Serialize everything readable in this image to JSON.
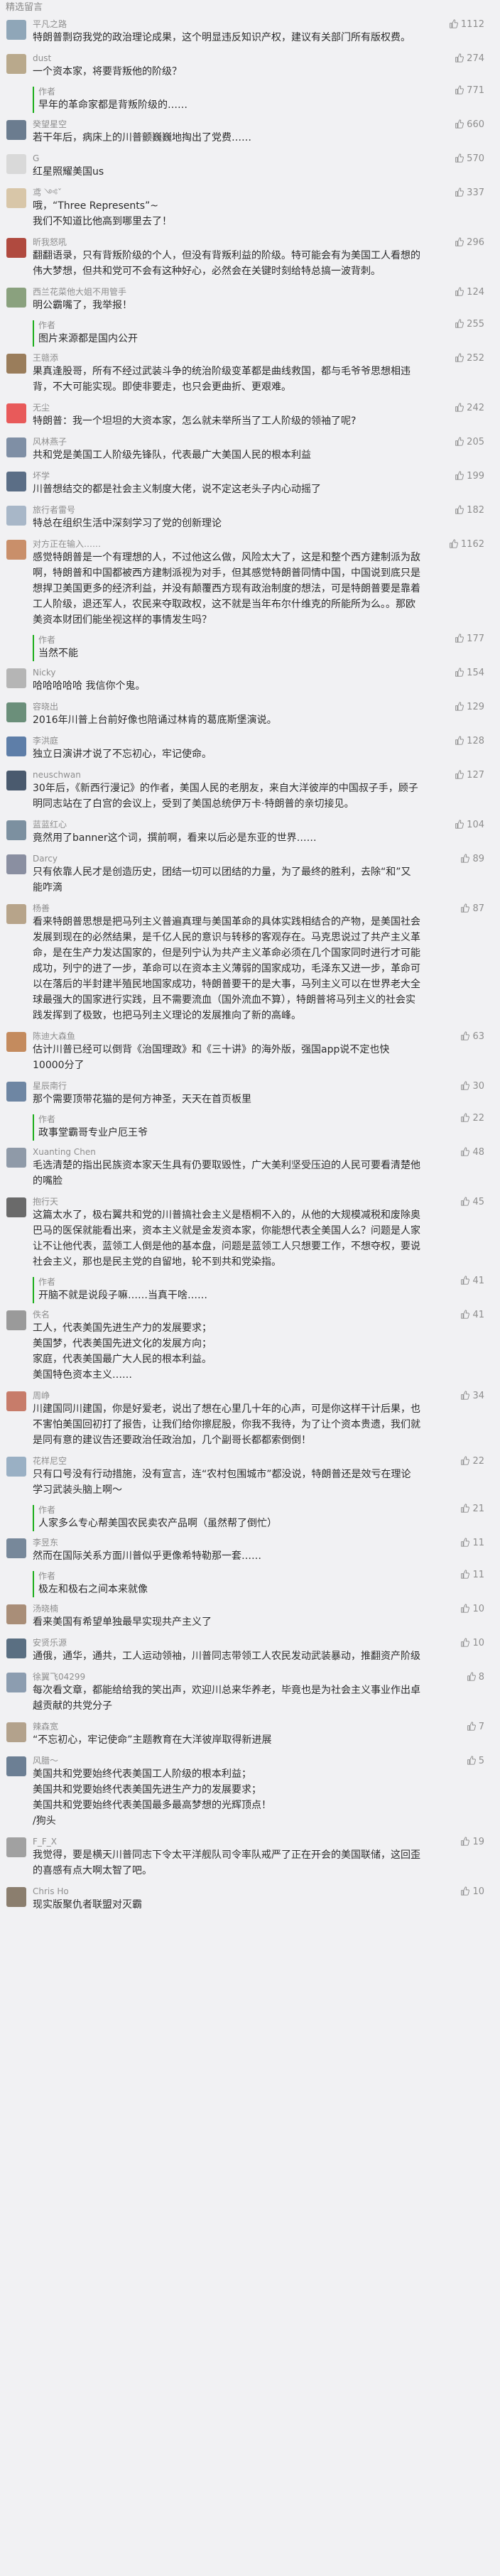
{
  "section_title": "精选留言",
  "colors": {
    "accent_green": "#1aad19",
    "text_gray": "#8e8e8e",
    "background": "#f1f1f3"
  },
  "icons": {
    "like": "thumbs-up-icon",
    "avatar": "user-avatar"
  },
  "comments": [
    {
      "name": "平凡之路",
      "likes": "1112",
      "text": "特朗普剽窃我党的政治理论成果，这个明显违反知识产权，建议有关部门所有版权费。",
      "avatar_color": "#8fa6b8"
    },
    {
      "name": "dust",
      "likes": "274",
      "text": "一个资本家，将要背叛他的阶级？",
      "avatar_color": "#b9a98c",
      "reply": {
        "author": "作者",
        "likes": "771",
        "text": "早年的革命家都是背叛阶级的……"
      }
    },
    {
      "name": "癸望星空",
      "likes": "660",
      "text": "若干年后，病床上的川普颤巍巍地掏出了党费……",
      "avatar_color": "#6b7c8f"
    },
    {
      "name": "G",
      "likes": "570",
      "text": "红星照耀美国us",
      "avatar_color": "#d9d9d9"
    },
    {
      "name": "鸢 ༺ˇ",
      "likes": "337",
      "text": "哦，“Three Represents”~\n我们不知道比他高到哪里去了！",
      "avatar_color": "#d8c6a8"
    },
    {
      "name": "昕我怒吼",
      "likes": "296",
      "text": "翻翻语录，只有背叛阶级的个人，但没有背叛利益的阶级。特可能会有为美国工人看想的伟大梦想，但共和党可不会有这种好心，必然会在关键时刻给特总搞一波背刺。",
      "avatar_color": "#b04a3f"
    },
    {
      "name": "西兰花菜他大姐不用管手",
      "likes": "124",
      "text": "明公霸嘴了，我举报！",
      "avatar_color": "#8aa17e",
      "reply": {
        "author": "作者",
        "likes": "255",
        "text": "图片来源都是国内公开"
      }
    },
    {
      "name": "王赣添",
      "likes": "252",
      "text": "果真逢股哥，所有不经过武装斗争的统治阶级变革都是曲线救国，都与毛爷爷思想相违背，不大可能实现。即使非要走，也只会更曲折、更艰难。",
      "avatar_color": "#9a7d5b"
    },
    {
      "name": "无尘",
      "likes": "242",
      "text": "特朗普：我一个坦坦的大资本家，怎么就未举所当了工人阶级的领袖了呢?",
      "avatar_color": "#e85a5a"
    },
    {
      "name": "风林燕子",
      "likes": "205",
      "text": "共和党是美国工人阶级先锋队，代表最广大美国人民的根本利益",
      "avatar_color": "#7f8fa5"
    },
    {
      "name": "坏学",
      "likes": "199",
      "text": "川普想结交的都是社会主义制度大佬，说不定这老头子内心动摇了",
      "avatar_color": "#5b6e86"
    },
    {
      "name": "旅行者雷号",
      "likes": "182",
      "text": "特总在组织生活中深刻学习了党的创新理论",
      "avatar_color": "#a8b7c8"
    },
    {
      "name": "对方正在输入……",
      "likes": "1162",
      "text": "感觉特朗普是一个有理想的人，不过他这么做，风险太大了，这是和整个西方建制派为敌啊，特朗普和中国都被西方建制派视为对手，但其感觉特朗普同情中国，中国说到底只是想捍卫美国更多的经济利益，并没有颠覆西方现有政治制度的想法，可是特朗普要是靠着工人阶级，退还军人，农民来夺取政权，这不就是当年布尔什维克的所能所为么。。那欧美资本财团们能坐视这样的事情发生吗？",
      "avatar_color": "#c98f6a",
      "reply": {
        "author": "作者",
        "likes": "177",
        "text": "当然不能"
      }
    },
    {
      "name": "Nicky",
      "likes": "154",
      "text": "哈哈哈哈哈 我信你个鬼。",
      "avatar_color": "#b5b5b5"
    },
    {
      "name": "容晓出",
      "likes": "129",
      "text": "2016年川普上台前好像也陪诵过林肯的葛底斯堡演说。",
      "avatar_color": "#6b8f7a"
    },
    {
      "name": "李洪庭",
      "likes": "128",
      "text": "独立日演讲才说了不忘初心，牢记使命。",
      "avatar_color": "#5e7ea8"
    },
    {
      "name": "neuschwan",
      "likes": "127",
      "text": "30年后，《新西行漫记》的作者，美国人民的老朋友，来自大洋彼岸的中国叔子手，顾子明同志站在了白宫的会议上，受到了美国总统伊万卡·特朗普的亲切接见。",
      "avatar_color": "#4a5a6e"
    },
    {
      "name": "蓝蓝红心",
      "likes": "104",
      "text": "竟然用了banner这个词，撰前啊，看来以后必是东亚的世界……",
      "avatar_color": "#7c90a0"
    },
    {
      "name": "Darcy",
      "likes": "89",
      "text": "只有依靠人民才是创造历史，团结一切可以团结的力量，为了最终的胜利，去除“和”又能咋滴",
      "avatar_color": "#8a8fa1"
    },
    {
      "name": "杨善",
      "likes": "87",
      "text": "看来特朗普思想是把马列主义普遍真理与美国革命的具体实践相结合的产物，是美国社会发展到现在的必然结果，是千亿人民的意识与转移的客观存在。马克思说过了共产主义革命，是在生产力发达国家的，但是列宁认为共产主义革命必须在几个国家同时进行才可能成功，列宁的进了一步，革命可以在资本主义薄弱的国家成功，毛泽东又进一步，革命可以在落后的半封建半殖民地国家成功，特朗普要干的是大事，马列主义可以在世界老大全球最强大的国家进行实践，且不需要流血（国外流血不算），特朗普将马列主义的社会实践发挥到了极致，也把马列主义理论的发展推向了新的高峰。",
      "avatar_color": "#b7a48a"
    },
    {
      "name": "陈迪大森鱼",
      "likes": "63",
      "text": "估计川普已经可以倒背《治国理政》和《三十讲》的海外版，强国app说不定也快10000分了",
      "avatar_color": "#c48b5e"
    },
    {
      "name": "星辰南行",
      "likes": "30",
      "text": "那个需要顶带花猫的是何方神圣，天天在首页板里",
      "avatar_color": "#6e86a3",
      "reply": {
        "author": "作者",
        "likes": "22",
        "text": "政事堂霸哥专业户厄王爷"
      }
    },
    {
      "name": "Xuanting Chen",
      "likes": "48",
      "text": "毛选清楚的指出民族资本家天生具有仍要取毁性，广大美利坚受压迫的人民可要看清楚他的嘴脸",
      "avatar_color": "#8f9aa8"
    },
    {
      "name": "抱行天",
      "likes": "45",
      "text": "这篇太水了，极右翼共和党的川普搞社会主义是梧桐不入的，从他的大规模减税和废除奥巴马的医保就能看出来，资本主义就是金发资本家，你能想代表全美国人么？问题是人家让不让他代表，蓝领工人倒是他的基本盘，问题是蓝领工人只想要工作，不想夺权，要说社会主义，那也是民主党的自留地，轮不到共和党染指。",
      "avatar_color": "#6a6a6a",
      "reply": {
        "author": "作者",
        "likes": "41",
        "text": "开脑不就是说段子嘛……当真干啥……"
      }
    },
    {
      "name": "佚名",
      "likes": "41",
      "text": "工人，代表美国先进生产力的发展要求；\n美国梦，代表美国先进文化的发展方向；\n家庭，代表美国最广大人民的根本利益。\n美国特色资本主义……",
      "avatar_color": "#9a9a9a"
    },
    {
      "name": "周峥",
      "likes": "34",
      "text": "川建国同川建国，你是好爱老，说出了想在心里几十年的心声，可是你这样干计后果，也不害怕美国回初打了报告，让我们给你擦屁股，你我不我待，为了让个资本贵遗，我们就是同有意的建议告还要政治任政治加，几个副哥长都都索倒倒！",
      "avatar_color": "#c77c6a"
    },
    {
      "name": "花样尼空",
      "likes": "22",
      "text": "只有口号没有行动措施，没有宣言，连“农村包围城市”都没说，特朗普还是效亏在理论学习武装头脑上啊～",
      "avatar_color": "#9ab0c4",
      "reply": {
        "author": "作者",
        "likes": "21",
        "text": "人家多么专心帮美国农民卖农产品啊（虽然帮了倒忙）"
      }
    },
    {
      "name": "李昱东",
      "likes": "11",
      "text": "然而在国际关系方面川普似乎更像希特勒那一套……",
      "avatar_color": "#77889a",
      "reply": {
        "author": "作者",
        "likes": "11",
        "text": "极左和极右之间本来就像"
      }
    },
    {
      "name": "汤晓楠",
      "likes": "10",
      "text": "看来美国有希望单独最早实现共产主义了",
      "avatar_color": "#a98e78"
    },
    {
      "name": "安贤乐源",
      "likes": "10",
      "text": "通俄，通华，通共，工人运动领袖，川普同志带领工人农民发动武装暴动，推翻资产阶级",
      "avatar_color": "#5a6f82"
    },
    {
      "name": "徐翼飞04299",
      "likes": "8",
      "text": "每次看文章，都能给给我的笑出声，欢迎川总来华养老，毕竟也是为社会主义事业作出卓越贡献的共党分子",
      "avatar_color": "#8c9db0"
    },
    {
      "name": "辣森宽",
      "likes": "7",
      "text": "“不忘初心，牢记使命”主题教育在大洋彼岸取得新进展",
      "avatar_color": "#b3a28c"
    },
    {
      "name": "风腊～",
      "likes": "5",
      "text": "美国共和党要始终代表美国工人阶级的根本利益；\n美国共和党要始终代表美国先进生产力的发展要求；\n美国共和党要始终代表美国最多最高梦想的光辉顶点！\n/狗头",
      "avatar_color": "#6c7f94"
    },
    {
      "name": "F_F_X",
      "likes": "19",
      "text": "我觉得，要是横天川普同志下令太平洋舰队司令率队戒严了正在开会的美国联储，这回歪的喜感有点大啊太智了吧。",
      "avatar_color": "#a1a1a1"
    },
    {
      "name": "Chris Ho",
      "likes": "10",
      "text": "现实版聚仇者联盟对灭霸",
      "avatar_color": "#8b7e6e"
    }
  ]
}
